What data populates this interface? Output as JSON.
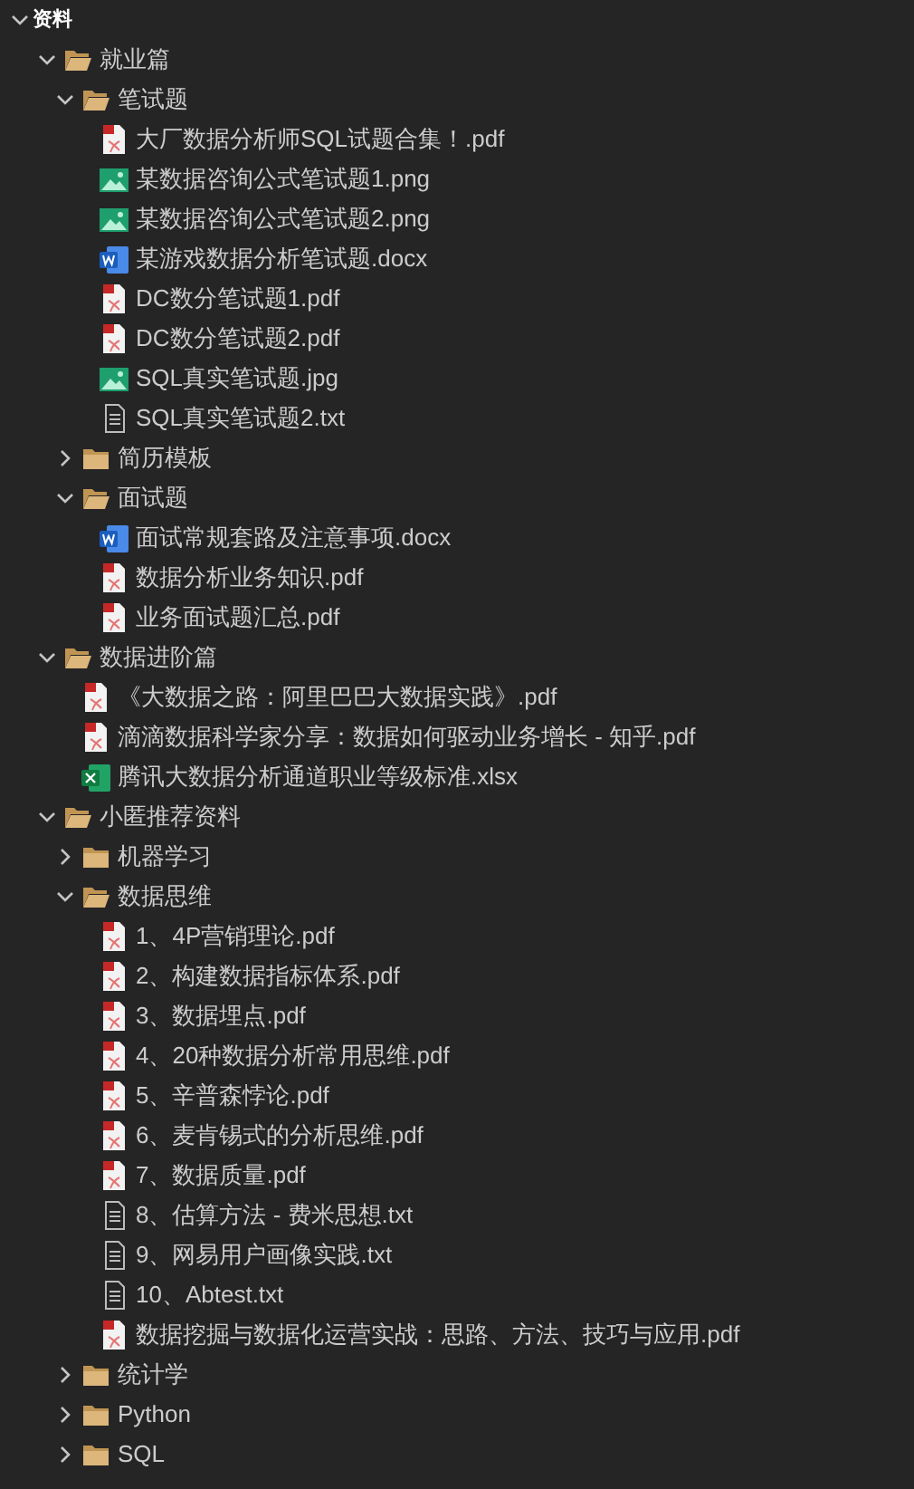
{
  "explorer": {
    "root": {
      "label": "资料",
      "expanded": true,
      "children": [
        {
          "kind": "folder",
          "label": "就业篇",
          "expanded": true,
          "children": [
            {
              "kind": "folder",
              "label": "笔试题",
              "expanded": true,
              "children": [
                {
                  "kind": "pdf",
                  "label": "大厂数据分析师SQL试题合集！.pdf"
                },
                {
                  "kind": "image",
                  "label": "某数据咨询公式笔试题1.png"
                },
                {
                  "kind": "image",
                  "label": "某数据咨询公式笔试题2.png"
                },
                {
                  "kind": "word",
                  "label": "某游戏数据分析笔试题.docx"
                },
                {
                  "kind": "pdf",
                  "label": "DC数分笔试题1.pdf"
                },
                {
                  "kind": "pdf",
                  "label": "DC数分笔试题2.pdf"
                },
                {
                  "kind": "image",
                  "label": "SQL真实笔试题.jpg"
                },
                {
                  "kind": "text",
                  "label": "SQL真实笔试题2.txt"
                }
              ]
            },
            {
              "kind": "folder",
              "label": "简历模板",
              "expanded": false
            },
            {
              "kind": "folder",
              "label": "面试题",
              "expanded": true,
              "children": [
                {
                  "kind": "word",
                  "label": "面试常规套路及注意事项.docx"
                },
                {
                  "kind": "pdf",
                  "label": "数据分析业务知识.pdf"
                },
                {
                  "kind": "pdf",
                  "label": "业务面试题汇总.pdf"
                }
              ]
            }
          ]
        },
        {
          "kind": "folder",
          "label": "数据进阶篇",
          "expanded": true,
          "children": [
            {
              "kind": "pdf",
              "label": "《大数据之路：阿里巴巴大数据实践》.pdf"
            },
            {
              "kind": "pdf",
              "label": "滴滴数据科学家分享：数据如何驱动业务增长 - 知乎.pdf"
            },
            {
              "kind": "excel",
              "label": "腾讯大数据分析通道职业等级标准.xlsx"
            }
          ]
        },
        {
          "kind": "folder",
          "label": "小匿推荐资料",
          "expanded": true,
          "children": [
            {
              "kind": "folder",
              "label": "机器学习",
              "expanded": false
            },
            {
              "kind": "folder",
              "label": "数据思维",
              "expanded": true,
              "children": [
                {
                  "kind": "pdf",
                  "label": "1、4P营销理论.pdf"
                },
                {
                  "kind": "pdf",
                  "label": "2、构建数据指标体系.pdf"
                },
                {
                  "kind": "pdf",
                  "label": "3、数据埋点.pdf"
                },
                {
                  "kind": "pdf",
                  "label": "4、20种数据分析常用思维.pdf"
                },
                {
                  "kind": "pdf",
                  "label": "5、辛普森悖论.pdf"
                },
                {
                  "kind": "pdf",
                  "label": "6、麦肯锡式的分析思维.pdf"
                },
                {
                  "kind": "pdf",
                  "label": "7、数据质量.pdf"
                },
                {
                  "kind": "text",
                  "label": "8、估算方法 - 费米思想.txt"
                },
                {
                  "kind": "text",
                  "label": "9、网易用户画像实践.txt"
                },
                {
                  "kind": "text",
                  "label": "10、Abtest.txt"
                },
                {
                  "kind": "pdf",
                  "label": "数据挖掘与数据化运营实战：思路、方法、技巧与应用.pdf"
                }
              ]
            },
            {
              "kind": "folder",
              "label": "统计学",
              "expanded": false
            },
            {
              "kind": "folder",
              "label": "Python",
              "expanded": false
            },
            {
              "kind": "folder",
              "label": "SQL",
              "expanded": false
            }
          ]
        }
      ]
    }
  }
}
